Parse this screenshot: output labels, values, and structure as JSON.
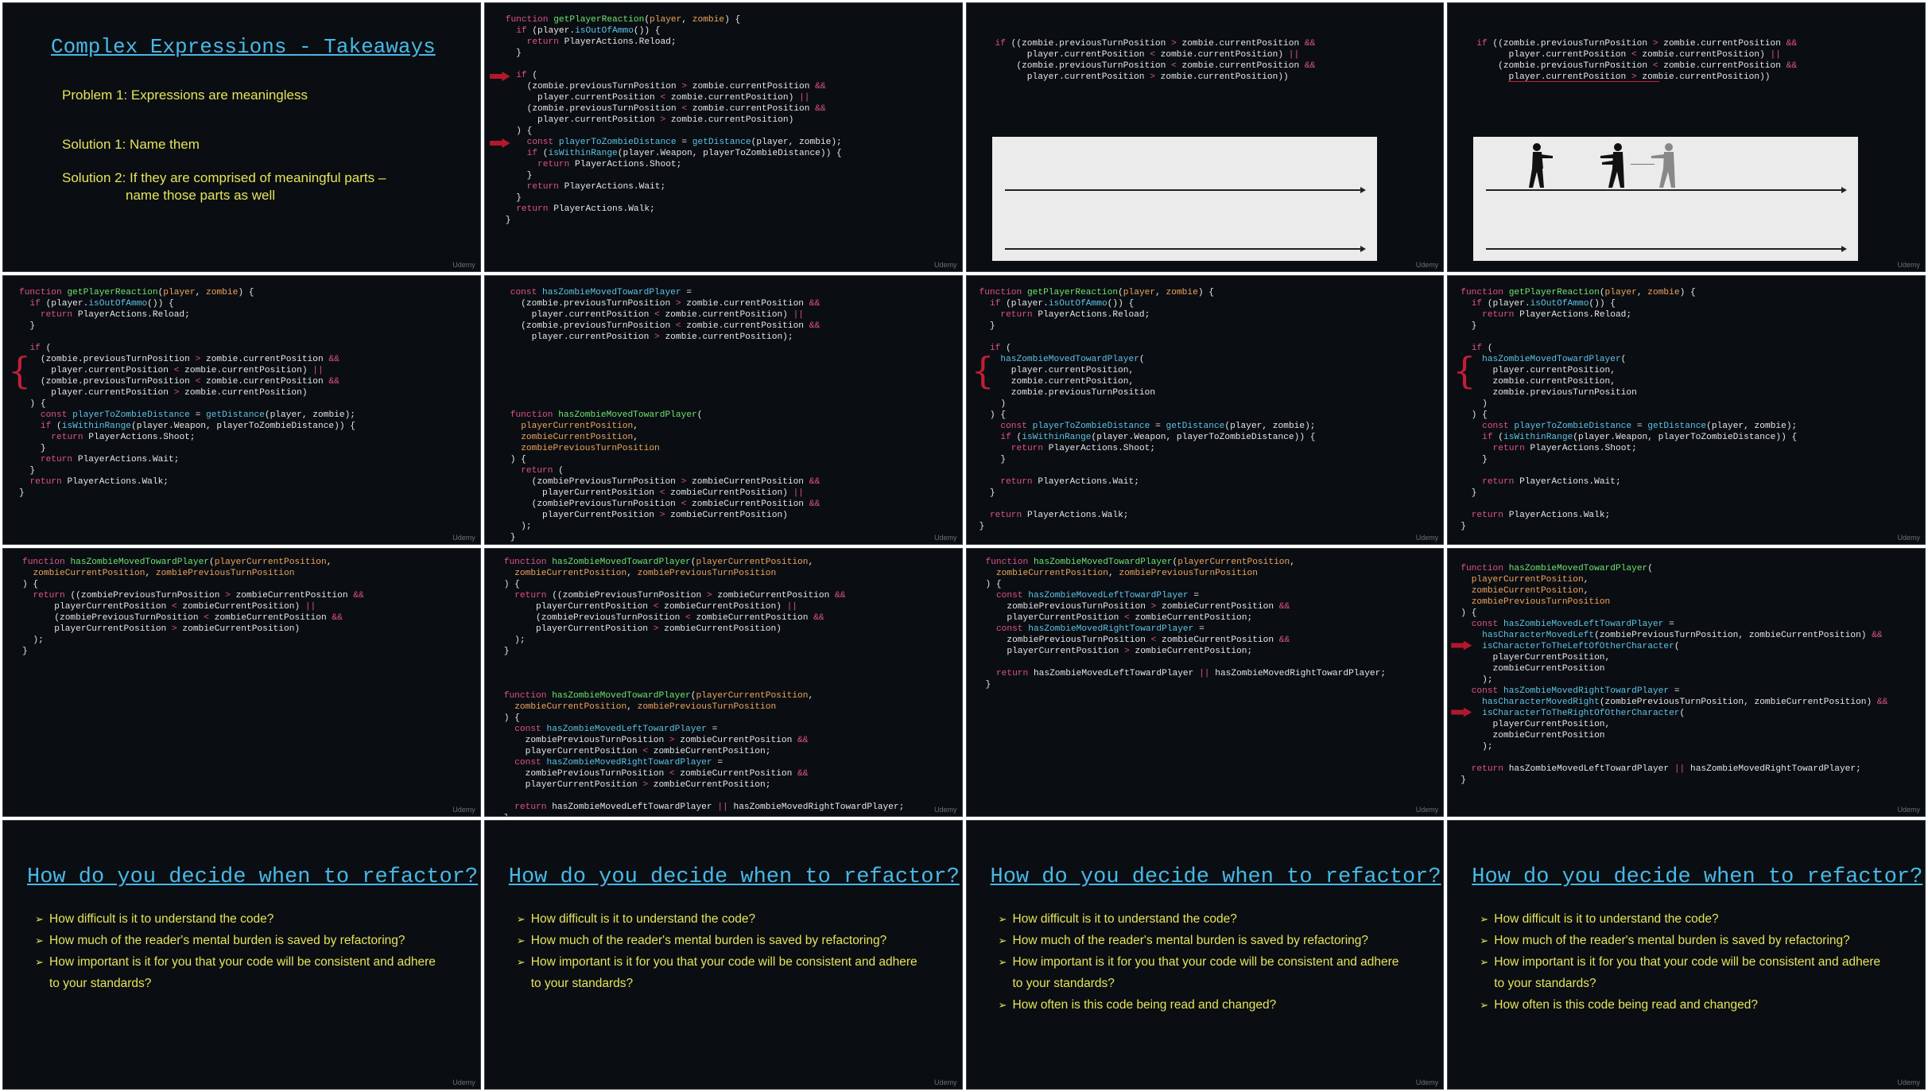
{
  "watermark": "Udemy",
  "takeaways": {
    "title": "Complex Expressions - Takeaways",
    "problem": "Problem 1: Expressions are meaningless",
    "solution1": "Solution 1: Name them",
    "solution2_line1": "Solution 2: If they are comprised of meaningful parts –",
    "solution2_line2": "name those parts as well"
  },
  "refactor": {
    "title": "How do you decide when to refactor?",
    "q1": "How difficult is it to understand the code?",
    "q2": "How much of the reader's mental burden is saved by refactoring?",
    "q3": "How important is it for you that your code will be consistent and adhere to your standards?",
    "q4": "How often is this code being read and changed?"
  },
  "colors": {
    "slide_bg": "#0a0e12",
    "keyword": "#e0518a",
    "function_name": "#6fe36f",
    "parameter": "#f0a35c",
    "method": "#5ec3e8",
    "title_link": "#48b8e6",
    "yellow_text": "#e6e35a",
    "arrow_marker": "#b1182c"
  },
  "icons": [
    "red-arrow-marker-icon",
    "red-brace-marker-icon",
    "player-silhouette-icon",
    "zombie-silhouette-icon",
    "bullet-arrow-icon"
  ]
}
